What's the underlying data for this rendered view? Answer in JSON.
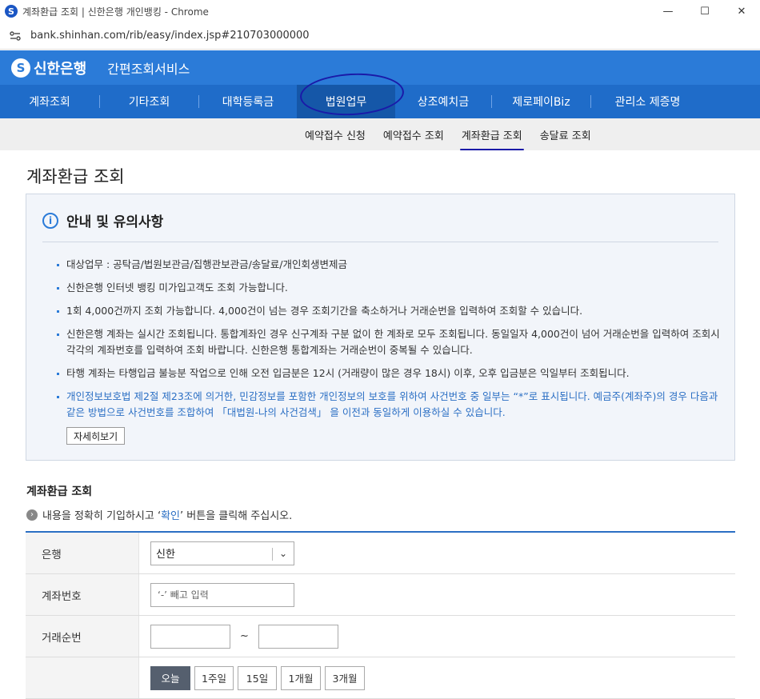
{
  "browser": {
    "tab_title": "계좌환급 조회 | 신한은행 개인뱅킹 - Chrome",
    "url": "bank.shinhan.com/rib/easy/index.jsp#210703000000",
    "favicon": "S"
  },
  "header": {
    "brand_logo": "S",
    "brand_name": "신한은행",
    "service_name": "간편조회서비스",
    "accent_color": "#2b7bd8"
  },
  "nav": {
    "items": [
      {
        "label": "계좌조회"
      },
      {
        "label": "기타조회"
      },
      {
        "label": "대학등록금"
      },
      {
        "label": "법원업무"
      },
      {
        "label": "상조예치금"
      },
      {
        "label": "제로페이Biz"
      },
      {
        "label": "관리소 제증명"
      }
    ],
    "active_index": 3
  },
  "subnav": {
    "items": [
      {
        "label": "예약접수 신청"
      },
      {
        "label": "예약접수 조회"
      },
      {
        "label": "계좌환급 조회"
      },
      {
        "label": "송달료 조회"
      }
    ],
    "active_index": 2
  },
  "page": {
    "title": "계좌환급 조회"
  },
  "notice": {
    "title": "안내 및 유의사항",
    "items": [
      "대상업무 : 공탁금/법원보관금/집행관보관금/송달료/개인회생변제금",
      "신한은행 인터넷 뱅킹 미가입고객도 조회 가능합니다.",
      "1회 4,000건까지 조회 가능합니다. 4,000건이 넘는 경우 조회기간을 축소하거나 거래순번을 입력하여 조회할 수 있습니다.",
      "신한은행 계좌는 실시간 조회됩니다. 통합계좌인 경우 신구계좌 구분 없이 한 계좌로 모두 조회됩니다. 동일일자 4,000건이 넘어 거래순번을 입력하여 조회시 각각의 계좌번호를 입력하여 조회 바랍니다. 신한은행 통합계좌는 거래순번이 중복될 수 있습니다.",
      "타행 계좌는 타행입금 불능분 작업으로 인해 오전 입금분은 12시 (거래량이 많은 경우 18시) 이후, 오후 입금분은 익일부터 조회됩니다.",
      "개인정보보호법 제2절 제23조에 의거한, 민감정보를 포함한 개인정보의 보호를 위하여 사건번호 중 일부는 “*”로 표시됩니다. 예금주(계좌주)의 경우 다음과 같은 방법으로 사건번호를 조합하여 「대법원-나의 사건검색」 을 이전과 동일하게 이용하실 수 있습니다."
    ],
    "detail_button": "자세히보기"
  },
  "form": {
    "section_title": "계좌환급 조회",
    "hint_prefix": "내용을 정확히 기입하시고 ‘",
    "hint_emph": "확인",
    "hint_suffix": "’ 버튼을 클릭해 주십시오.",
    "bank_label": "은행",
    "bank_value": "신한",
    "account_label": "계좌번호",
    "account_placeholder": "‘-’ 빼고 입력",
    "seq_label": "거래순번",
    "seq_from": "",
    "seq_to": "",
    "tilde": "~",
    "period_buttons": [
      "오늘",
      "1주일",
      "15일",
      "1개월",
      "3개월"
    ],
    "period_active_index": 0
  }
}
